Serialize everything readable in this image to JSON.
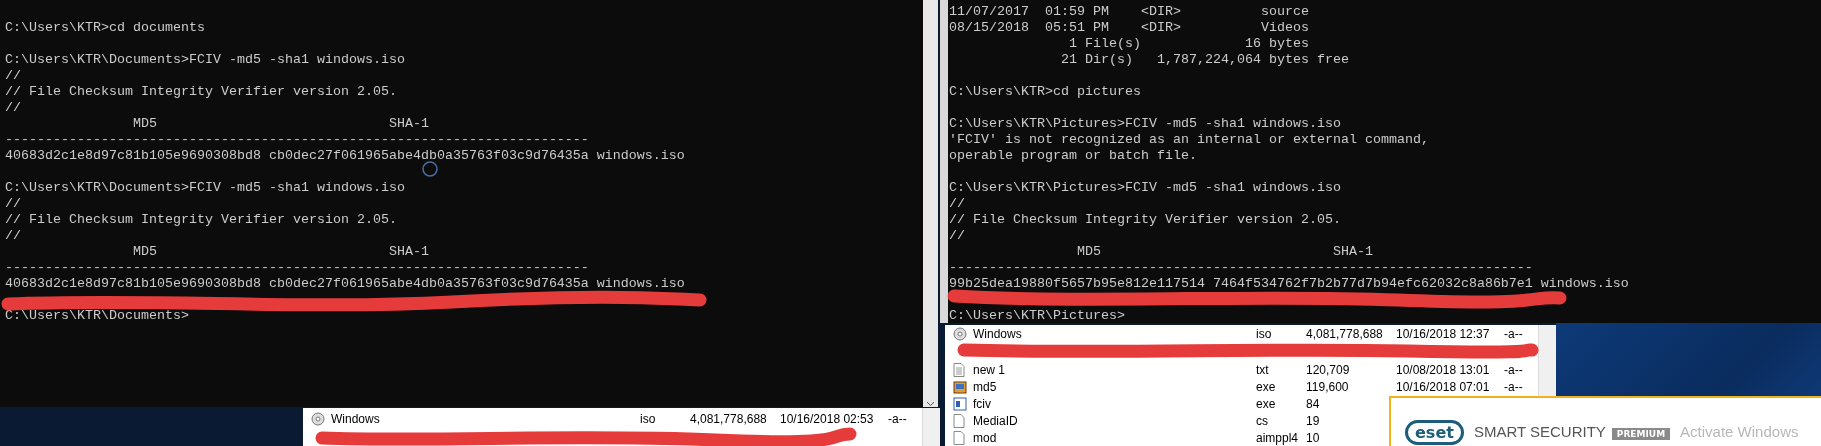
{
  "left_console": {
    "blocks": [
      [
        "C:\\Users\\KTR>cd documents"
      ],
      [
        "C:\\Users\\KTR\\Documents>FCIV -md5 -sha1 windows.iso",
        "//",
        "// File Checksum Integrity Verifier version 2.05.",
        "//",
        "                MD5                             SHA-1",
        "-------------------------------------------------------------------------",
        "40683d2c1e8d97c81b105e9690308bd8 cb0dec27f061965abe4db0a35763f03c9d76435a windows.iso"
      ],
      [
        "C:\\Users\\KTR\\Documents>FCIV -md5 -sha1 windows.iso",
        "//",
        "// File Checksum Integrity Verifier version 2.05.",
        "//",
        "                MD5                             SHA-1",
        "-------------------------------------------------------------------------",
        "40683d2c1e8d97c81b105e9690308bd8 cb0dec27f061965abe4db0a35763f03c9d76435a windows.iso"
      ],
      [
        "C:\\Users\\KTR\\Documents>"
      ]
    ]
  },
  "right_console": {
    "blocks": [
      [
        "11/07/2017  01:59 PM    <DIR>          source",
        "08/15/2018  05:51 PM    <DIR>          Videos",
        "               1 File(s)             16 bytes",
        "              21 Dir(s)   1,787,224,064 bytes free"
      ],
      [
        "C:\\Users\\KTR>cd pictures"
      ],
      [
        "C:\\Users\\KTR\\Pictures>FCIV -md5 -sha1 windows.iso",
        "'FCIV' is not recognized as an internal or external command,",
        "operable program or batch file."
      ],
      [
        "C:\\Users\\KTR\\Pictures>FCIV -md5 -sha1 windows.iso",
        "//",
        "// File Checksum Integrity Verifier version 2.05.",
        "//",
        "                MD5                             SHA-1",
        "-------------------------------------------------------------------------",
        "99b25dea19880f5657b95e812e117514 7464f534762f7b2b77d7b94efc62032c8a86b7e1 windows.iso"
      ],
      [
        "C:\\Users\\KTR\\Pictures>"
      ]
    ]
  },
  "left_file_list": {
    "rows": [
      {
        "kind": "disc",
        "name": "Windows",
        "ext": "iso",
        "size": "4,081,778,688",
        "date": "10/16/2018 02:53",
        "attr": "-a--"
      }
    ]
  },
  "right_file_list": {
    "rows": [
      {
        "kind": "disc",
        "name": "Windows",
        "ext": "iso",
        "size": "4,081,778,688",
        "date": "10/16/2018 12:37",
        "attr": "-a--"
      },
      {
        "kind": "text",
        "name": "new 1",
        "ext": "txt",
        "size": "120,709",
        "date": "10/08/2018 13:01",
        "attr": "-a--"
      },
      {
        "kind": "app",
        "name": "md5",
        "ext": "exe",
        "size": "119,600",
        "date": "10/16/2018 07:01",
        "attr": "-a--"
      },
      {
        "kind": "program",
        "name": "fciv",
        "ext": "exe",
        "size": "84"
      },
      {
        "kind": "file",
        "name": "MediaID",
        "ext": "cs",
        "size": "19"
      },
      {
        "kind": "file",
        "name": "mod",
        "ext": "aimppl4",
        "size": "10"
      }
    ]
  },
  "notification": {
    "logo": "eset",
    "product": "SMART SECURITY",
    "edition": "PREMIUM",
    "activation_notice": "Activate Windows"
  }
}
